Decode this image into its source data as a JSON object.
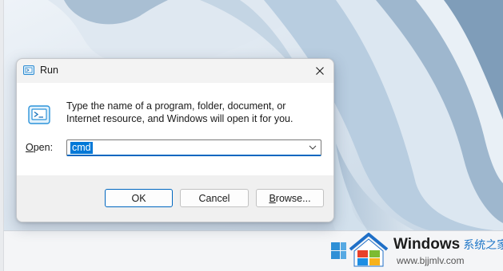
{
  "dialog": {
    "title": "Run",
    "description": "Type the name of a program, folder, document, or Internet resource, and Windows will open it for you.",
    "open_label_access": "O",
    "open_label_rest": "pen:",
    "input_value": "cmd",
    "buttons": {
      "ok": "OK",
      "cancel": "Cancel",
      "browse_access": "B",
      "browse_rest": "rowse..."
    }
  },
  "watermark": {
    "title": "Windows",
    "title_cn": "系统之家",
    "url": "www.bjjmlv.com"
  },
  "colors": {
    "accent": "#0067c0",
    "selection": "#0078d7",
    "wallpaper": "#c9d8e6"
  },
  "icons": [
    "run-icon",
    "close-icon",
    "chevron-down-icon",
    "windows-logo-icon",
    "brand-logo-icon"
  ]
}
